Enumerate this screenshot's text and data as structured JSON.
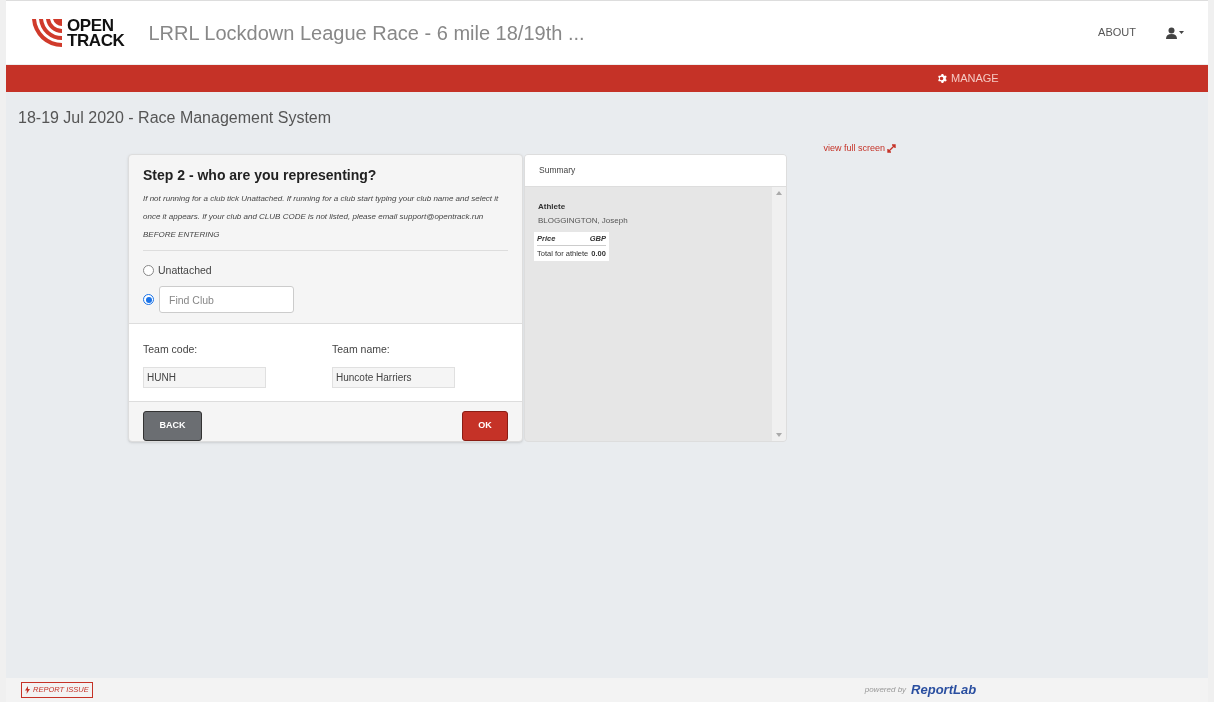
{
  "header": {
    "logo_line1": "OPEN",
    "logo_line2": "TRACK",
    "title": "LRRL Lockdown League Race - 6 mile 18/19th ...",
    "nav": [
      {
        "label": "ABOUT"
      }
    ]
  },
  "red_bar": {
    "label": "MANAGE"
  },
  "page_title": "18-19 Jul 2020 - Race Management System",
  "view_full_screen": "view full screen",
  "step": {
    "title": "Step 2 - who are you representing?",
    "instructions": "If not running for a club tick Unattached. If running for a club start typing your club name and select it once it appears. If your club and CLUB CODE is not listed, please email support@opentrack.run BEFORE ENTERING",
    "options": [
      {
        "kind": "label",
        "label": "Unattached",
        "selected": false
      },
      {
        "kind": "field",
        "placeholder": "Find Club",
        "selected": true
      }
    ],
    "team_code": {
      "label": "Team code:",
      "value": "HUNH"
    },
    "team_name": {
      "label": "Team name:",
      "value": "Huncote Harriers"
    },
    "back": "BACK",
    "ok": "OK"
  },
  "summary": {
    "title": "Summary",
    "athlete_label": "Athlete",
    "athlete_name": "BLOGGINGTON, Joseph",
    "price_label": "Price",
    "currency": "GBP",
    "total_label": "Total for athlete",
    "total_value": "0.00"
  },
  "footer": {
    "report": "REPORT ISSUE",
    "powered_by": "powered by",
    "brand": "ReportLab"
  }
}
